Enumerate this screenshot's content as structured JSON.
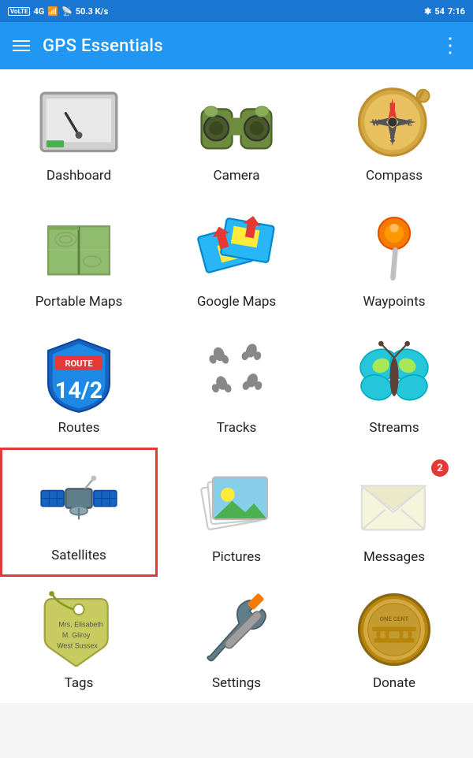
{
  "statusBar": {
    "volte": "VoLTE",
    "4g": "4G",
    "speed": "50.3 K/s",
    "battery": "54",
    "time": "7:16"
  },
  "appBar": {
    "title": "GPS Essentials",
    "menuLabel": "Menu",
    "moreLabel": "More"
  },
  "grid": [
    {
      "id": "dashboard",
      "label": "Dashboard",
      "icon": "dashboard",
      "selected": false,
      "badge": 0
    },
    {
      "id": "camera",
      "label": "Camera",
      "icon": "camera",
      "selected": false,
      "badge": 0
    },
    {
      "id": "compass",
      "label": "Compass",
      "icon": "compass",
      "selected": false,
      "badge": 0
    },
    {
      "id": "portable-maps",
      "label": "Portable Maps",
      "icon": "portable-maps",
      "selected": false,
      "badge": 0
    },
    {
      "id": "google-maps",
      "label": "Google Maps",
      "icon": "google-maps",
      "selected": false,
      "badge": 0
    },
    {
      "id": "waypoints",
      "label": "Waypoints",
      "icon": "waypoints",
      "selected": false,
      "badge": 0
    },
    {
      "id": "routes",
      "label": "Routes",
      "icon": "routes",
      "selected": false,
      "badge": 0
    },
    {
      "id": "tracks",
      "label": "Tracks",
      "icon": "tracks",
      "selected": false,
      "badge": 0
    },
    {
      "id": "streams",
      "label": "Streams",
      "icon": "streams",
      "selected": false,
      "badge": 0
    },
    {
      "id": "satellites",
      "label": "Satellites",
      "icon": "satellites",
      "selected": true,
      "badge": 0
    },
    {
      "id": "pictures",
      "label": "Pictures",
      "icon": "pictures",
      "selected": false,
      "badge": 0
    },
    {
      "id": "messages",
      "label": "Messages",
      "icon": "messages",
      "selected": false,
      "badge": 2
    },
    {
      "id": "tags",
      "label": "Tags",
      "icon": "tags",
      "selected": false,
      "badge": 0
    },
    {
      "id": "settings",
      "label": "Settings",
      "icon": "settings",
      "selected": false,
      "badge": 0
    },
    {
      "id": "donate",
      "label": "Donate",
      "icon": "donate",
      "selected": false,
      "badge": 0
    }
  ]
}
